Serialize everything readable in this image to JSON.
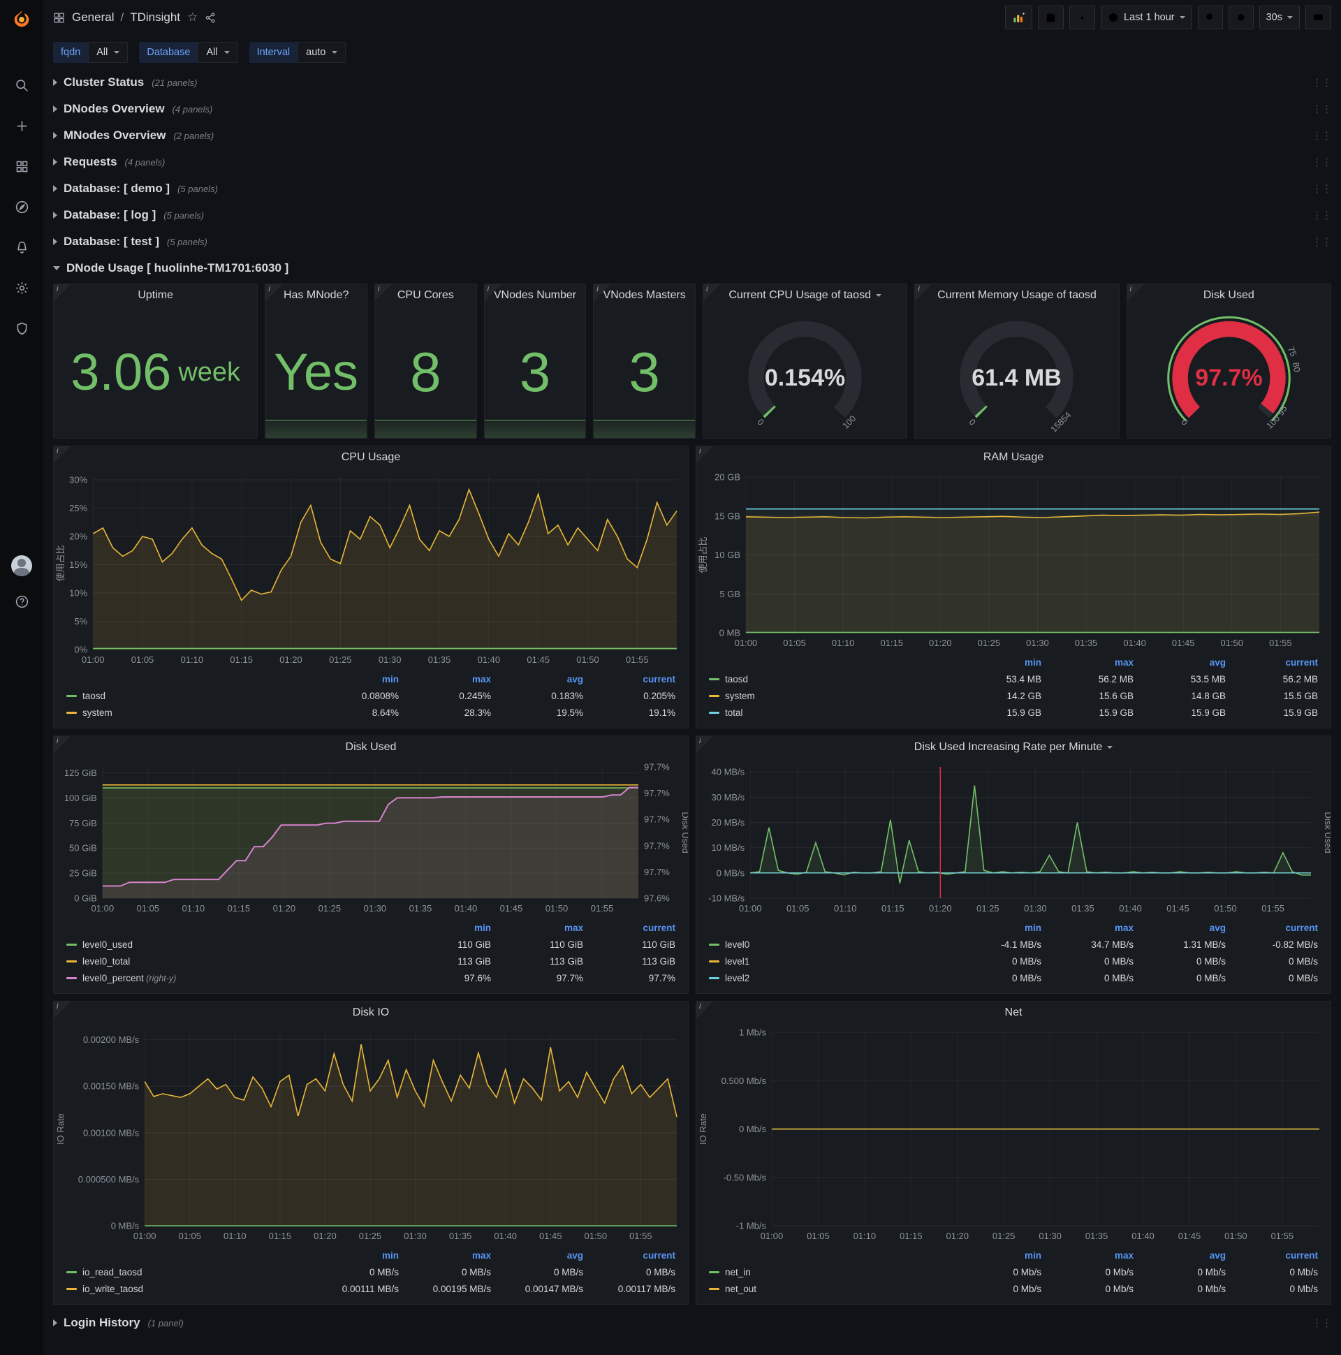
{
  "icons": {
    "star": "☆",
    "drag": "⋮⋮",
    "info": "i"
  },
  "colors": {
    "green": "#73bf69",
    "yellow": "#eab839",
    "cyan": "#6ed0e0",
    "red": "#e02f44",
    "pink": "#d683ce",
    "blue_header": "#5794f2"
  },
  "topnav": {
    "root": "General",
    "sep": "/",
    "title": "TDinsight",
    "time_range": "Last 1 hour",
    "refresh_interval": "30s"
  },
  "variables": [
    {
      "label": "fqdn",
      "value": "All"
    },
    {
      "label": "Database",
      "value": "All"
    },
    {
      "label": "Interval",
      "value": "auto"
    }
  ],
  "rows": [
    {
      "title": "Cluster Status",
      "count": "(21 panels)"
    },
    {
      "title": "DNodes Overview",
      "count": "(4 panels)"
    },
    {
      "title": "MNodes Overview",
      "count": "(2 panels)"
    },
    {
      "title": "Requests",
      "count": "(4 panels)"
    },
    {
      "title": "Database: [ demo ]",
      "count": "(5 panels)"
    },
    {
      "title": "Database: [ log ]",
      "count": "(5 panels)"
    },
    {
      "title": "Database: [ test ]",
      "count": "(5 panels)"
    }
  ],
  "dnode_row": {
    "title": "DNode Usage [ huolinhe-TM1701:6030 ]"
  },
  "login_row": {
    "title": "Login History",
    "count": "(1 panel)"
  },
  "stats": [
    {
      "title": "Uptime",
      "value": "3.06",
      "suffix": "week"
    },
    {
      "title": "Has MNode?",
      "value": "Yes"
    },
    {
      "title": "CPU Cores",
      "value": "8"
    },
    {
      "title": "VNodes Number",
      "value": "3"
    },
    {
      "title": "VNodes Masters",
      "value": "3"
    }
  ],
  "gauges": [
    {
      "title": "Current CPU Usage of taosd",
      "value": 0.154,
      "min": 0,
      "max": 100,
      "text": "0.154%",
      "color": "#73bf69",
      "value_color": "#d8d9da",
      "ring": false,
      "labels": [
        {
          "t": "0",
          "f": 0
        },
        {
          "t": "100",
          "f": 1
        }
      ]
    },
    {
      "title": "Current Memory Usage of taosd",
      "value": 61.4,
      "min": 0,
      "max": 15854,
      "text": "61.4 MB",
      "color": "#73bf69",
      "value_color": "#d8d9da",
      "ring": false,
      "labels": [
        {
          "t": "0",
          "f": 0
        },
        {
          "t": "15854",
          "f": 1
        }
      ]
    },
    {
      "title": "Disk Used",
      "value": 97.7,
      "min": 0,
      "max": 100,
      "text": "97.7%",
      "color": "#e02f44",
      "value_color": "#e02f44",
      "ring": true,
      "labels": [
        {
          "t": "0",
          "f": 0
        },
        {
          "t": "75",
          "f": 0.75
        },
        {
          "t": "80",
          "f": 0.8
        },
        {
          "t": "95",
          "f": 0.95
        },
        {
          "t": "100",
          "f": 1
        }
      ]
    }
  ],
  "charts_common": {
    "xrange": [
      0,
      59
    ],
    "xticks": [
      {
        "v": 0,
        "t": "01:00"
      },
      {
        "v": 5,
        "t": "01:05"
      },
      {
        "v": 10,
        "t": "01:10"
      },
      {
        "v": 15,
        "t": "01:15"
      },
      {
        "v": 20,
        "t": "01:20"
      },
      {
        "v": 25,
        "t": "01:25"
      },
      {
        "v": 30,
        "t": "01:30"
      },
      {
        "v": 35,
        "t": "01:35"
      },
      {
        "v": 40,
        "t": "01:40"
      },
      {
        "v": 45,
        "t": "01:45"
      },
      {
        "v": 50,
        "t": "01:50"
      },
      {
        "v": 55,
        "t": "01:55"
      }
    ]
  },
  "charts": {
    "cpu": {
      "title": "CPU Usage",
      "type": "line",
      "ylabel": "使用占比",
      "yrange": [
        0,
        30.5
      ],
      "yticks": [
        {
          "v": 0,
          "t": "0%"
        },
        {
          "v": 5,
          "t": "5%"
        },
        {
          "v": 10,
          "t": "10%"
        },
        {
          "v": 15,
          "t": "15%"
        },
        {
          "v": 20,
          "t": "20%"
        },
        {
          "v": 25,
          "t": "25%"
        },
        {
          "v": 30,
          "t": "30%"
        }
      ],
      "series": [
        {
          "name": "system",
          "color": "#eab839",
          "fill": 0.12,
          "w": 1.6,
          "points": [
            20.5,
            21.5,
            18,
            16.5,
            17.5,
            20,
            19.5,
            15.5,
            17,
            19.5,
            21.5,
            18.5,
            17,
            16,
            12.5,
            8.7,
            10.5,
            9.8,
            10.2,
            14,
            16.5,
            22.5,
            25.5,
            19,
            16,
            15.2,
            21,
            19.5,
            23.5,
            22,
            18,
            21.5,
            25.5,
            19.5,
            17.5,
            21,
            20,
            23,
            28.3,
            24,
            19.5,
            16.5,
            20.5,
            18.5,
            22.5,
            27.5,
            20.5,
            22,
            18.5,
            21.5,
            19.5,
            17.5,
            23,
            20,
            16,
            14.5,
            19.5,
            26,
            22,
            24.5
          ]
        },
        {
          "name": "taosd",
          "color": "#73bf69",
          "fill": 0.1,
          "w": 1.6,
          "points": [
            0.2,
            0.2
          ]
        }
      ],
      "legend": {
        "cols": [
          "min",
          "max",
          "avg",
          "current"
        ],
        "rows": [
          {
            "name": "taosd",
            "color": "#73bf69",
            "values": [
              "0.0808%",
              "0.245%",
              "0.183%",
              "0.205%"
            ]
          },
          {
            "name": "system",
            "color": "#eab839",
            "values": [
              "8.64%",
              "28.3%",
              "19.5%",
              "19.1%"
            ]
          }
        ]
      }
    },
    "ram": {
      "title": "RAM Usage",
      "type": "line",
      "ylabel": "使用占比",
      "yrange": [
        0,
        20
      ],
      "yticks": [
        {
          "v": 0,
          "t": "0 MB"
        },
        {
          "v": 5,
          "t": "5 GB"
        },
        {
          "v": 10,
          "t": "10 GB"
        },
        {
          "v": 15,
          "t": "15 GB"
        },
        {
          "v": 20,
          "t": "20 GB"
        }
      ],
      "series": [
        {
          "name": "total",
          "color": "#6ed0e0",
          "fill": 0.05,
          "w": 1.6,
          "points": [
            15.9,
            15.9
          ]
        },
        {
          "name": "system",
          "color": "#eab839",
          "fill": 0.1,
          "w": 1.6,
          "points": [
            14.9,
            14.85,
            14.8,
            14.85,
            14.9,
            14.8,
            14.75,
            14.85,
            14.9,
            14.85,
            14.8,
            14.85,
            14.9,
            14.95,
            14.85,
            14.8,
            14.9,
            15.0,
            15.1,
            15.05,
            15.1,
            15.15,
            15.1,
            15.2,
            15.15,
            15.2,
            15.25,
            15.2,
            15.3,
            15.5
          ]
        },
        {
          "name": "taosd",
          "color": "#73bf69",
          "fill": 0.1,
          "w": 1.6,
          "points": [
            0.055,
            0.055
          ]
        }
      ],
      "legend": {
        "cols": [
          "min",
          "max",
          "avg",
          "current"
        ],
        "rows": [
          {
            "name": "taosd",
            "color": "#73bf69",
            "values": [
              "53.4 MB",
              "56.2 MB",
              "53.5 MB",
              "56.2 MB"
            ]
          },
          {
            "name": "system",
            "color": "#eab839",
            "values": [
              "14.2 GB",
              "15.6 GB",
              "14.8 GB",
              "15.5 GB"
            ]
          },
          {
            "name": "total",
            "color": "#6ed0e0",
            "values": [
              "15.9 GB",
              "15.9 GB",
              "15.9 GB",
              "15.9 GB"
            ]
          }
        ]
      }
    },
    "disk": {
      "title": "Disk Used",
      "type": "line",
      "yrange": [
        0,
        131
      ],
      "yticks": [
        {
          "v": 0,
          "t": "0 GiB"
        },
        {
          "v": 25,
          "t": "25 GiB"
        },
        {
          "v": 50,
          "t": "50 GiB"
        },
        {
          "v": 75,
          "t": "75 GiB"
        },
        {
          "v": 100,
          "t": "100 GiB"
        },
        {
          "v": 125,
          "t": "125 GiB"
        }
      ],
      "y2label": "Disk Used",
      "y2range": [
        97.59,
        97.73
      ],
      "y2ticks": [
        {
          "v": 97.59,
          "t": "97.6%"
        },
        {
          "v": 97.618,
          "t": "97.7%"
        },
        {
          "v": 97.646,
          "t": "97.7%"
        },
        {
          "v": 97.674,
          "t": "97.7%"
        },
        {
          "v": 97.702,
          "t": "97.7%"
        },
        {
          "v": 97.73,
          "t": "97.7%"
        }
      ],
      "series": [
        {
          "name": "level0_used",
          "color": "#73bf69",
          "fill": 0.12,
          "w": 1.6,
          "points": [
            110,
            110
          ]
        },
        {
          "name": "level0_total",
          "color": "#eab839",
          "fill": 0.06,
          "w": 1.6,
          "points": [
            113,
            113
          ]
        },
        {
          "name": "level0_percent",
          "color": "#d683ce",
          "fill": 0.1,
          "w": 2,
          "axis": "y2",
          "points": [
            97.603,
            97.603,
            97.603,
            97.607,
            97.607,
            97.607,
            97.607,
            97.607,
            97.61,
            97.61,
            97.61,
            97.61,
            97.61,
            97.61,
            97.62,
            97.63,
            97.63,
            97.645,
            97.645,
            97.655,
            97.668,
            97.668,
            97.668,
            97.668,
            97.668,
            97.67,
            97.67,
            97.672,
            97.672,
            97.672,
            97.672,
            97.672,
            97.69,
            97.697,
            97.697,
            97.697,
            97.697,
            97.697,
            97.698,
            97.698,
            97.698,
            97.698,
            97.698,
            97.698,
            97.698,
            97.698,
            97.698,
            97.698,
            97.698,
            97.698,
            97.698,
            97.698,
            97.698,
            97.698,
            97.698,
            97.698,
            97.698,
            97.7,
            97.7,
            97.708,
            97.708
          ]
        }
      ],
      "legend": {
        "cols": [
          "min",
          "max",
          "current"
        ],
        "rows": [
          {
            "name": "level0_used",
            "color": "#73bf69",
            "values": [
              "110 GiB",
              "110 GiB",
              "110 GiB"
            ]
          },
          {
            "name": "level0_total",
            "color": "#eab839",
            "values": [
              "113 GiB",
              "113 GiB",
              "113 GiB"
            ]
          },
          {
            "name": "level0_percent",
            "note": "(right-y)",
            "color": "#d683ce",
            "values": [
              "97.6%",
              "97.7%",
              "97.7%"
            ]
          }
        ]
      }
    },
    "diskrate": {
      "title": "Disk Used Increasing Rate per Minute",
      "type": "line",
      "yrange": [
        -10,
        42
      ],
      "yticks": [
        {
          "v": -10,
          "t": "-10 MB/s"
        },
        {
          "v": 0,
          "t": "0 MB/s"
        },
        {
          "v": 10,
          "t": "10 MB/s"
        },
        {
          "v": 20,
          "t": "20 MB/s"
        },
        {
          "v": 30,
          "t": "30 MB/s"
        },
        {
          "v": 40,
          "t": "40 MB/s"
        }
      ],
      "y2label": "Disk Used",
      "annotations": [
        {
          "x": 20,
          "color": "#e02f44"
        }
      ],
      "series": [
        {
          "name": "level0",
          "color": "#73bf69",
          "fill": 0.12,
          "w": 1.6,
          "points": [
            0,
            0.5,
            18,
            1,
            0,
            -0.5,
            0.3,
            12,
            0.5,
            0,
            -0.8,
            0.3,
            0,
            0,
            0.5,
            21,
            -4.1,
            13,
            0.5,
            0,
            0.3,
            -0.5,
            0,
            0.5,
            34.7,
            1,
            0,
            0.5,
            0,
            0.3,
            0,
            0.5,
            7,
            0.5,
            0,
            20,
            0.5,
            0,
            0.3,
            0,
            0,
            0.5,
            0,
            0.3,
            0,
            0,
            0.5,
            0,
            0,
            0.3,
            0,
            0,
            0.5,
            0,
            0,
            0.3,
            0,
            8,
            0.5,
            -0.82,
            -0.82
          ]
        },
        {
          "name": "level1",
          "color": "#eab839",
          "w": 1.4,
          "points": [
            0,
            0
          ]
        },
        {
          "name": "level2",
          "color": "#6ed0e0",
          "w": 1.4,
          "points": [
            0,
            0
          ]
        }
      ],
      "legend": {
        "cols": [
          "min",
          "max",
          "avg",
          "current"
        ],
        "rows": [
          {
            "name": "level0",
            "color": "#73bf69",
            "values": [
              "-4.1 MB/s",
              "34.7 MB/s",
              "1.31 MB/s",
              "-0.82 MB/s"
            ]
          },
          {
            "name": "level1",
            "color": "#eab839",
            "values": [
              "0 MB/s",
              "0 MB/s",
              "0 MB/s",
              "0 MB/s"
            ]
          },
          {
            "name": "level2",
            "color": "#6ed0e0",
            "values": [
              "0 MB/s",
              "0 MB/s",
              "0 MB/s",
              "0 MB/s"
            ]
          }
        ]
      }
    },
    "diskio": {
      "title": "Disk IO",
      "type": "line",
      "ylabel": "IO Rate",
      "yrange": [
        0,
        0.00208
      ],
      "yticks": [
        {
          "v": 0,
          "t": "0 MB/s"
        },
        {
          "v": 0.0005,
          "t": "0.000500 MB/s"
        },
        {
          "v": 0.001,
          "t": "0.00100 MB/s"
        },
        {
          "v": 0.0015,
          "t": "0.00150 MB/s"
        },
        {
          "v": 0.002,
          "t": "0.00200 MB/s"
        }
      ],
      "series": [
        {
          "name": "io_write_taosd",
          "color": "#eab839",
          "fill": 0.12,
          "w": 1.6,
          "points": [
            0.00155,
            0.00139,
            0.00142,
            0.0014,
            0.00138,
            0.00142,
            0.0015,
            0.00158,
            0.00147,
            0.00152,
            0.00138,
            0.00135,
            0.0016,
            0.00148,
            0.00128,
            0.00155,
            0.00162,
            0.00118,
            0.00152,
            0.00158,
            0.00145,
            0.00185,
            0.00152,
            0.00134,
            0.00195,
            0.00145,
            0.00158,
            0.00178,
            0.00138,
            0.00168,
            0.00145,
            0.00128,
            0.00178,
            0.00155,
            0.00134,
            0.00162,
            0.00148,
            0.00186,
            0.00152,
            0.00138,
            0.00168,
            0.00132,
            0.00158,
            0.00148,
            0.00135,
            0.00192,
            0.00145,
            0.00155,
            0.00138,
            0.00165,
            0.00148,
            0.00132,
            0.00158,
            0.00172,
            0.00142,
            0.00152,
            0.00138,
            0.00148,
            0.00158,
            0.00117
          ]
        },
        {
          "name": "io_read_taosd",
          "color": "#73bf69",
          "w": 1.6,
          "points": [
            0,
            0
          ]
        }
      ],
      "legend": {
        "cols": [
          "min",
          "max",
          "avg",
          "current"
        ],
        "rows": [
          {
            "name": "io_read_taosd",
            "color": "#73bf69",
            "values": [
              "0 MB/s",
              "0 MB/s",
              "0 MB/s",
              "0 MB/s"
            ]
          },
          {
            "name": "io_write_taosd",
            "color": "#eab839",
            "values": [
              "0.00111 MB/s",
              "0.00195 MB/s",
              "0.00147 MB/s",
              "0.00117 MB/s"
            ]
          }
        ]
      }
    },
    "net": {
      "title": "Net",
      "type": "line",
      "ylabel": "IO Rate",
      "yrange": [
        -1,
        1
      ],
      "yticks": [
        {
          "v": -1,
          "t": "-1 Mb/s"
        },
        {
          "v": -0.5,
          "t": "-0.50 Mb/s"
        },
        {
          "v": 0,
          "t": "0 Mb/s"
        },
        {
          "v": 0.5,
          "t": "0.500 Mb/s"
        },
        {
          "v": 1,
          "t": "1 Mb/s"
        }
      ],
      "series": [
        {
          "name": "net_in",
          "color": "#73bf69",
          "w": 1.6,
          "points": [
            0,
            0
          ]
        },
        {
          "name": "net_out",
          "color": "#eab839",
          "w": 1.6,
          "points": [
            0,
            0
          ]
        }
      ],
      "legend": {
        "cols": [
          "min",
          "max",
          "avg",
          "current"
        ],
        "rows": [
          {
            "name": "net_in",
            "color": "#73bf69",
            "values": [
              "0 Mb/s",
              "0 Mb/s",
              "0 Mb/s",
              "0 Mb/s"
            ]
          },
          {
            "name": "net_out",
            "color": "#eab839",
            "values": [
              "0 Mb/s",
              "0 Mb/s",
              "0 Mb/s",
              "0 Mb/s"
            ]
          }
        ]
      }
    }
  }
}
